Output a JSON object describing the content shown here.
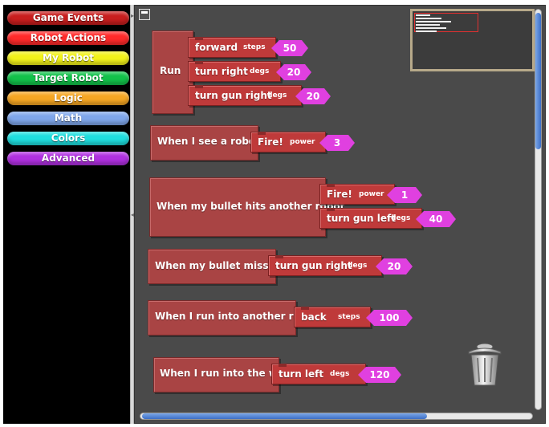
{
  "palette": {
    "categories": [
      {
        "label": "Game Events",
        "color": "#c81e1e"
      },
      {
        "label": "Robot Actions",
        "color": "#ff2a2a"
      },
      {
        "label": "My Robot",
        "color": "#f2f21a"
      },
      {
        "label": "Target Robot",
        "color": "#12c24a"
      },
      {
        "label": "Logic",
        "color": "#f5a623"
      },
      {
        "label": "Math",
        "color": "#7fa6ea"
      },
      {
        "label": "Colors",
        "color": "#1fdede"
      },
      {
        "label": "Advanced",
        "color": "#b030e0"
      }
    ]
  },
  "workspace": {
    "blocks": [
      {
        "hat": "Run",
        "commands": [
          {
            "label": "forward",
            "param": "steps",
            "value": "50"
          },
          {
            "label": "turn right",
            "param": "degs",
            "value": "20"
          },
          {
            "label": "turn gun right",
            "param": "degs",
            "value": "20"
          }
        ]
      },
      {
        "hat": "When I see a robot",
        "commands": [
          {
            "label": "Fire!",
            "param": "power",
            "value": "3"
          }
        ]
      },
      {
        "hat": "When my bullet hits another robot",
        "commands": [
          {
            "label": "Fire!",
            "param": "power",
            "value": "1"
          },
          {
            "label": "turn gun left",
            "param": "degs",
            "value": "40"
          }
        ]
      },
      {
        "hat": "When my bullet misses",
        "commands": [
          {
            "label": "turn gun right",
            "param": "degs",
            "value": "20"
          }
        ]
      },
      {
        "hat": "When I run into another robot",
        "commands": [
          {
            "label": "back",
            "param": "steps",
            "value": "100"
          }
        ]
      },
      {
        "hat": "When I run into the wall",
        "commands": [
          {
            "label": "turn left",
            "param": "degs",
            "value": "120"
          }
        ]
      }
    ]
  },
  "icons": {
    "trash": "trash-can-icon",
    "collapse": "collapse-icon"
  }
}
